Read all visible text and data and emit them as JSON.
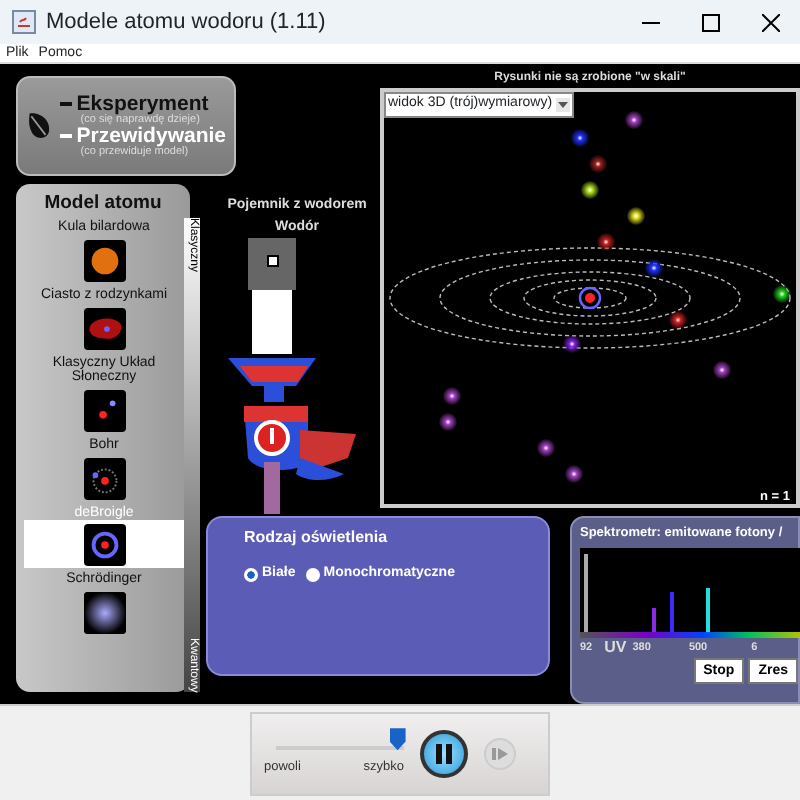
{
  "window": {
    "title": "Modele atomu wodoru (1.11)"
  },
  "menu": [
    "Plik",
    "Pomoc"
  ],
  "mode": {
    "options": [
      {
        "label": "Eksperyment",
        "hint": "(co się naprawdę dzieje)",
        "selected": false
      },
      {
        "label": "Przewidywanie",
        "hint": "(co przewiduje model)",
        "selected": true
      }
    ]
  },
  "models": {
    "title": "Model atomu",
    "scale_top": "Klasyczny",
    "scale_bottom": "Kwantowy",
    "items": [
      {
        "label": "Kula bilardowa",
        "kind": "billiard",
        "selected": false
      },
      {
        "label": "Ciasto z rodzynkami",
        "kind": "plum",
        "selected": false
      },
      {
        "label": "Klasyczny Układ Słoneczny",
        "kind": "solar",
        "selected": false
      },
      {
        "label": "Bohr",
        "kind": "bohr",
        "selected": false
      },
      {
        "label": "deBroigle",
        "kind": "debroglie",
        "selected": true
      },
      {
        "label": "Schrödinger",
        "kind": "schrodinger",
        "selected": false
      }
    ]
  },
  "container": {
    "label": "Pojemnik z wodorem",
    "sublabel": "Wodór"
  },
  "view": {
    "note": "Rysunki nie są zrobione \"w skali\"",
    "dropdown": "widok 3D (trój)wymiarowy)",
    "state": "n = 1"
  },
  "light": {
    "title": "Rodzaj oświetlenia",
    "options": [
      {
        "label": "Białe",
        "selected": true
      },
      {
        "label": "Monochromatyczne",
        "selected": false
      }
    ]
  },
  "spectrometer": {
    "title": "Spektrometr: emitowane fotony /",
    "ticks": [
      "92",
      "UV",
      "380",
      "500",
      "6"
    ],
    "buttons": [
      "Stop",
      "Zres"
    ]
  },
  "speed": {
    "slow": "powoli",
    "fast": "szybko",
    "level": 0.95,
    "running": true
  }
}
